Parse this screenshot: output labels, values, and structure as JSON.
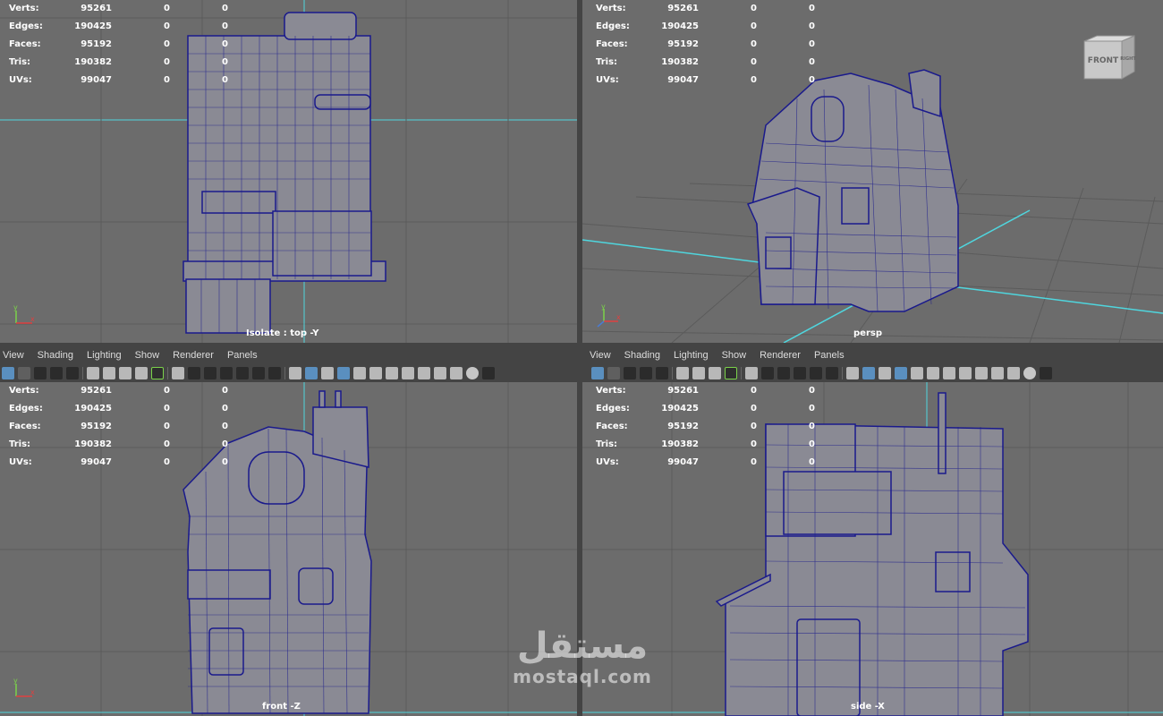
{
  "stats": {
    "labels": [
      "Verts:",
      "Edges:",
      "Faces:",
      "Tris:",
      "UVs:"
    ],
    "values": [
      "95261",
      "190425",
      "95192",
      "190382",
      "99047"
    ],
    "sel_a": [
      "0",
      "0",
      "0",
      "0",
      "0"
    ],
    "sel_b": [
      "0",
      "0",
      "0",
      "0",
      "0"
    ]
  },
  "viewports": {
    "top": {
      "name": "Isolate : top -Y"
    },
    "persp": {
      "name": "persp",
      "cube_label": "FRONT",
      "cube_side": "RIGHT"
    },
    "front": {
      "name": "front -Z"
    },
    "side": {
      "name": "side -X"
    }
  },
  "menus": [
    "View",
    "Shading",
    "Lighting",
    "Show",
    "Renderer",
    "Panels"
  ],
  "axis_labels": {
    "y": "y",
    "x": "x"
  },
  "watermark": {
    "arabic": "مستقل",
    "latin": "mostaql.com"
  },
  "colors": {
    "viewport_bg": "#6c6c6c",
    "grid_line": "#5b5b5b",
    "origin_axis": "#4fd6de",
    "wire": "#1a1a8c",
    "mesh_fill": "#8a8a94",
    "chrome_bg": "#444444"
  }
}
